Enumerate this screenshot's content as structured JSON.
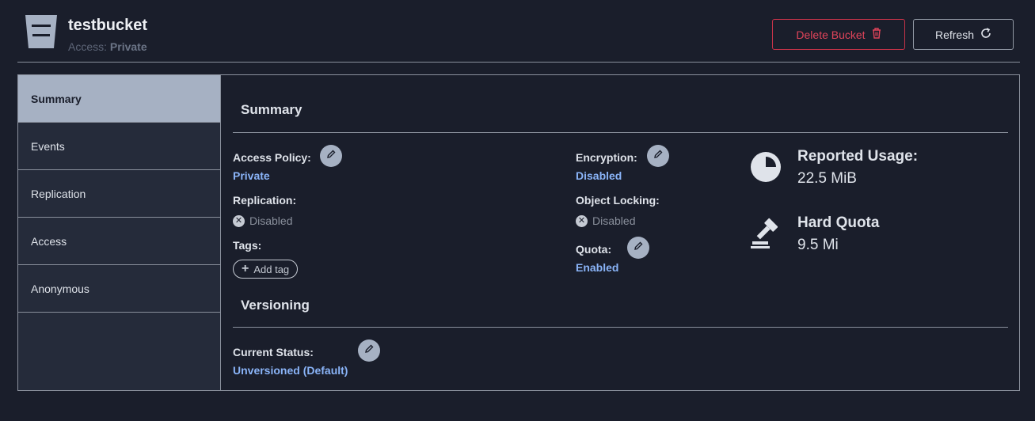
{
  "header": {
    "title": "testbucket",
    "access_label": "Access:",
    "access_value": "Private",
    "delete_label": "Delete Bucket",
    "refresh_label": "Refresh"
  },
  "sidebar": {
    "items": [
      {
        "label": "Summary",
        "active": true
      },
      {
        "label": "Events"
      },
      {
        "label": "Replication"
      },
      {
        "label": "Access"
      },
      {
        "label": "Anonymous"
      }
    ]
  },
  "summary": {
    "title": "Summary",
    "access_policy_label": "Access Policy:",
    "access_policy_value": "Private",
    "replication_label": "Replication:",
    "replication_value": "Disabled",
    "tags_label": "Tags:",
    "add_tag_label": "Add tag",
    "encryption_label": "Encryption:",
    "encryption_value": "Disabled",
    "object_locking_label": "Object Locking:",
    "object_locking_value": "Disabled",
    "quota_label": "Quota:",
    "quota_value": "Enabled",
    "reported_usage_title": "Reported Usage:",
    "reported_usage_value": "22.5 MiB",
    "hard_quota_title": "Hard Quota",
    "hard_quota_value": "9.5 Mi"
  },
  "versioning": {
    "title": "Versioning",
    "current_status_label": "Current Status:",
    "current_status_value": "Unversioned (Default)"
  },
  "colors": {
    "background": "#1a1e2b",
    "accent_link": "#8ab4f8",
    "danger": "#e0445a",
    "sidebar_active": "#a6b1c3"
  },
  "icons": [
    "bucket-icon",
    "trash-icon",
    "refresh-icon",
    "pencil-icon",
    "x-circle-icon",
    "plus-icon",
    "pie-chart-icon",
    "gavel-icon"
  ]
}
